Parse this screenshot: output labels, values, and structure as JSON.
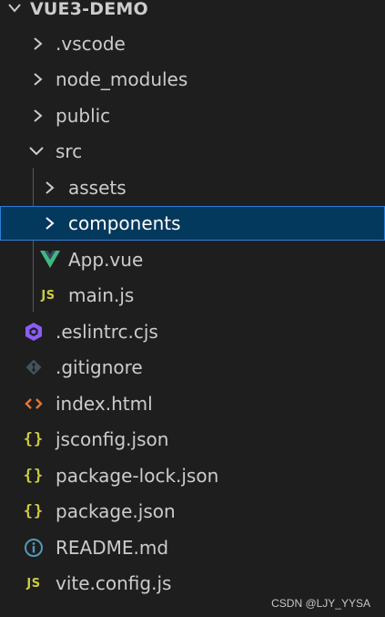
{
  "explorer": {
    "root_label": "VUE3-DEMO",
    "items": [
      {
        "label": ".vscode",
        "kind": "folder",
        "expanded": false,
        "icon": "chevron-right-icon"
      },
      {
        "label": "node_modules",
        "kind": "folder",
        "expanded": false,
        "icon": "chevron-right-icon"
      },
      {
        "label": "public",
        "kind": "folder",
        "expanded": false,
        "icon": "chevron-right-icon"
      },
      {
        "label": "src",
        "kind": "folder",
        "expanded": true,
        "icon": "chevron-down-icon"
      },
      {
        "label": "assets",
        "kind": "folder",
        "expanded": false,
        "icon": "chevron-right-icon"
      },
      {
        "label": "components",
        "kind": "folder",
        "expanded": false,
        "selected": true,
        "icon": "chevron-right-icon"
      },
      {
        "label": "App.vue",
        "kind": "file",
        "icon": "vue-icon"
      },
      {
        "label": "main.js",
        "kind": "file",
        "icon": "javascript-icon",
        "badge": "JS"
      },
      {
        "label": ".eslintrc.cjs",
        "kind": "file",
        "icon": "eslint-icon"
      },
      {
        "label": ".gitignore",
        "kind": "file",
        "icon": "git-icon"
      },
      {
        "label": "index.html",
        "kind": "file",
        "icon": "html-icon",
        "badge": "<>"
      },
      {
        "label": "jsconfig.json",
        "kind": "file",
        "icon": "json-icon",
        "badge": "{}"
      },
      {
        "label": "package-lock.json",
        "kind": "file",
        "icon": "json-icon",
        "badge": "{}"
      },
      {
        "label": "package.json",
        "kind": "file",
        "icon": "json-icon",
        "badge": "{}"
      },
      {
        "label": "README.md",
        "kind": "file",
        "icon": "info-icon"
      },
      {
        "label": "vite.config.js",
        "kind": "file",
        "icon": "javascript-icon",
        "badge": "JS"
      }
    ]
  },
  "watermark": "CSDN @LJY_YYSA",
  "colors": {
    "background": "#1e1e1e",
    "selection": "#04395e",
    "selection_border": "#2b7fd8",
    "vue_green": "#41b883",
    "js_yellow": "#cbcb41",
    "eslint_purple": "#8b5cf6",
    "git_gray": "#41535b",
    "html_orange": "#e37933",
    "info_blue": "#519aba"
  }
}
